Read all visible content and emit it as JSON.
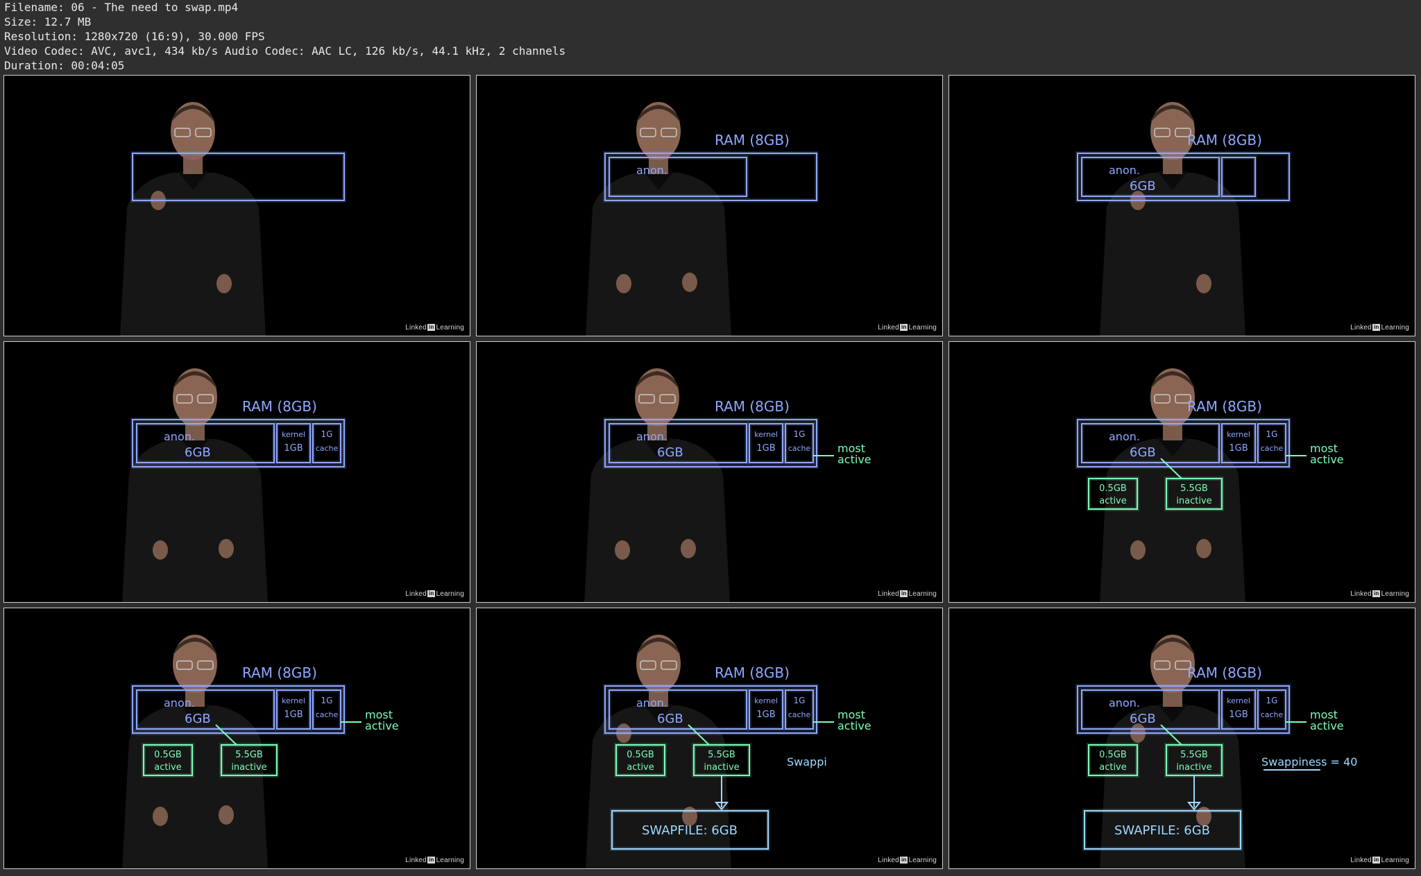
{
  "meta": {
    "filename": "Filename: 06 - The need to swap.mp4",
    "size": "Size: 12.7 MB",
    "resolution": "Resolution: 1280x720 (16:9), 30.000 FPS",
    "codec": "Video Codec: AVC, avc1, 434 kb/s Audio Codec: AAC LC, 126 kb/s, 44.1 kHz, 2 channels",
    "duration": "Duration: 00:04:05"
  },
  "watermark": {
    "prefix": "Linked",
    "box": "in",
    "suffix": "Learning"
  },
  "colors": {
    "ram_stroke": "#8fa8ff",
    "annotation_stroke": "#7dffb8",
    "swap_stroke": "#9fd8ff",
    "background": "#2f2f2f"
  },
  "handwriting": {
    "ram": "RAM (8GB)",
    "anon": "anon.",
    "anon_size": "6GB",
    "kernel": "kernel",
    "kernel_size": "1GB",
    "cache_size": "1G",
    "cache": "cache",
    "most": "most",
    "active": "active",
    "active_size": "0.5GB",
    "active_label": "active",
    "inactive_size": "5.5GB",
    "inactive_label": "inactive",
    "swapfile": "SWAPFILE: 6GB",
    "swappiness_partial": "Swappi",
    "swappiness": "Swappiness = 40"
  }
}
